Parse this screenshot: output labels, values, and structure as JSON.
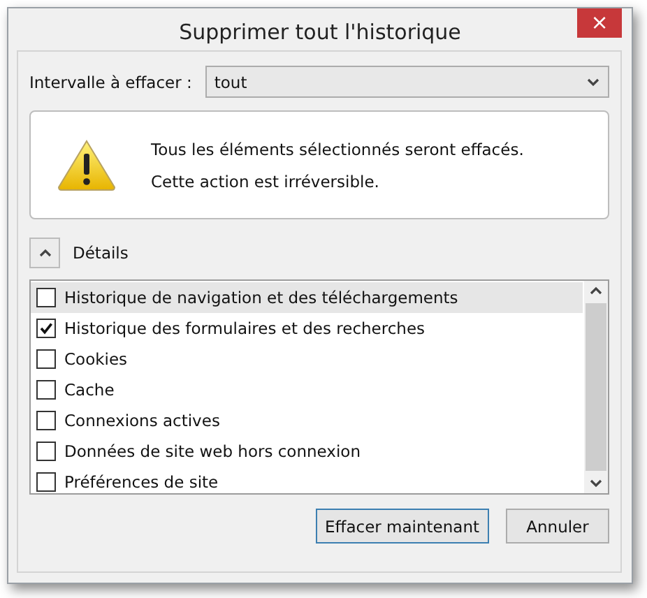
{
  "window": {
    "title": "Supprimer tout l'historique",
    "close": "×"
  },
  "range": {
    "label": "Intervalle à effacer :",
    "value": "tout"
  },
  "warning": {
    "lines": [
      "Tous les éléments sélectionnés seront effacés.",
      "Cette action est irréversible."
    ]
  },
  "details": {
    "label": "Détails",
    "expanded": true
  },
  "items": [
    {
      "label": "Historique de navigation et des téléchargements",
      "checked": false,
      "selected": true
    },
    {
      "label": "Historique des formulaires et des recherches",
      "checked": true,
      "selected": false
    },
    {
      "label": "Cookies",
      "checked": false,
      "selected": false
    },
    {
      "label": "Cache",
      "checked": false,
      "selected": false
    },
    {
      "label": "Connexions actives",
      "checked": false,
      "selected": false
    },
    {
      "label": "Données de site web hors connexion",
      "checked": false,
      "selected": false
    },
    {
      "label": "Préférences de site",
      "checked": false,
      "selected": false
    }
  ],
  "buttons": [
    {
      "label": "Effacer maintenant",
      "default": true
    },
    {
      "label": "Annuler",
      "default": false
    }
  ]
}
